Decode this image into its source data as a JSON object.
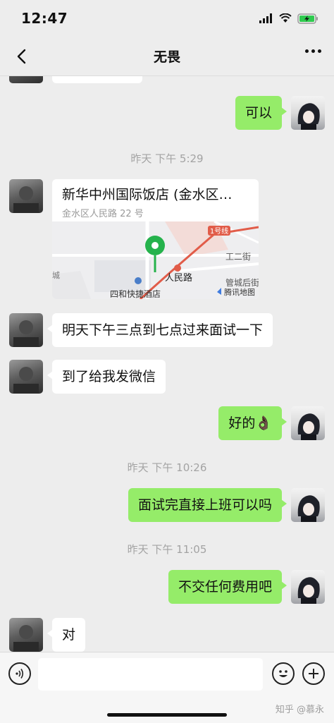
{
  "status": {
    "time": "12:47"
  },
  "header": {
    "title": "无畏"
  },
  "messages": {
    "m1": "可以",
    "ts1": "昨天 下午 5:29",
    "location": {
      "title": "新华中州国际饭店 (金水区…",
      "address": "金水区人民路 22 号",
      "map_labels": {
        "metro": "1号线",
        "road1": "工二街",
        "road2": "人民路",
        "road3": "管城后街",
        "hotel": "四和快捷酒店",
        "brand": "腾讯地图",
        "edge": "城"
      }
    },
    "m2": "明天下午三点到七点过来面试一下",
    "m3": "到了给我发微信",
    "m4": "好的👌🏿",
    "ts2": "昨天 下午 10:26",
    "m5": "面试完直接上班可以吗",
    "ts3": "昨天 下午 11:05",
    "m6": "不交任何费用吧",
    "m7": "对"
  },
  "footer": {
    "watermark": "知乎 @慕永"
  },
  "colors": {
    "sent_bubble": "#95ec69",
    "received_bubble": "#ffffff",
    "background": "#ededed"
  }
}
